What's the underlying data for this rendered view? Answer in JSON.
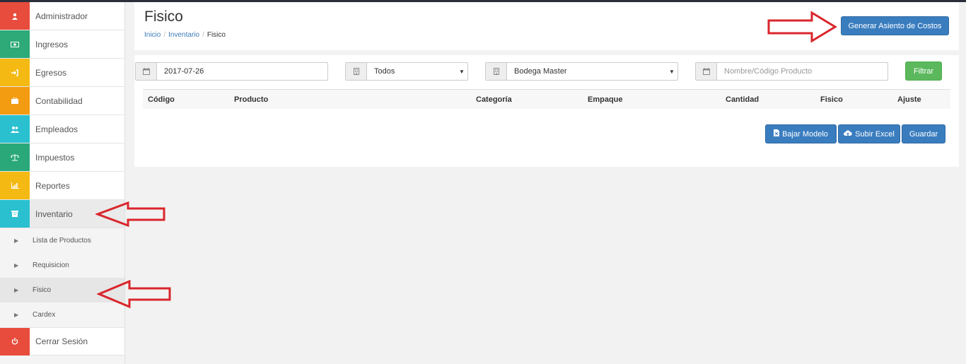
{
  "sidebar": {
    "items": [
      {
        "label": "Administrador",
        "icon": "user-icon",
        "color": "#e74c3c"
      },
      {
        "label": "Ingresos",
        "icon": "money-icon",
        "color": "#2daa77"
      },
      {
        "label": "Egresos",
        "icon": "sign-in-icon",
        "color": "#f5b914"
      },
      {
        "label": "Contabilidad",
        "icon": "briefcase-icon",
        "color": "#f39c12"
      },
      {
        "label": "Empleados",
        "icon": "users-icon",
        "color": "#2bc0d0"
      },
      {
        "label": "Impuestos",
        "icon": "balance-scale-icon",
        "color": "#2aa87a"
      },
      {
        "label": "Reportes",
        "icon": "bar-chart-icon",
        "color": "#f5b914"
      },
      {
        "label": "Inventario",
        "icon": "archive-icon",
        "color": "#2bc0d0"
      }
    ],
    "subitems": [
      {
        "label": "Lista de Productos"
      },
      {
        "label": "Requisicion"
      },
      {
        "label": "Fisico"
      },
      {
        "label": "Cardex"
      }
    ],
    "logout": {
      "label": "Cerrar Sesión",
      "icon": "power-icon",
      "color": "#e74c3c"
    }
  },
  "header": {
    "title": "Fisico",
    "breadcrumb": {
      "home": "Inicio",
      "section": "Inventario",
      "current": "Fisico",
      "separator": "/"
    },
    "costs_button": "Generar Asiento de Costos"
  },
  "filters": {
    "date": "2017-07-26",
    "category": "Todos",
    "warehouse": "Bodega Master",
    "product_placeholder": "Nombre/Código Producto",
    "filter_button": "Filtrar"
  },
  "table": {
    "columns": [
      "Código",
      "Producto",
      "Categoría",
      "Empaque",
      "Cantidad",
      "Fisico",
      "Ajuste"
    ]
  },
  "actions": {
    "download": "Bajar Modelo",
    "upload": "Subir Excel",
    "save": "Guardar"
  },
  "colors": {
    "primary": "#3a7dbf",
    "success": "#5cb85c",
    "annotation_arrow": "#d9262c"
  }
}
